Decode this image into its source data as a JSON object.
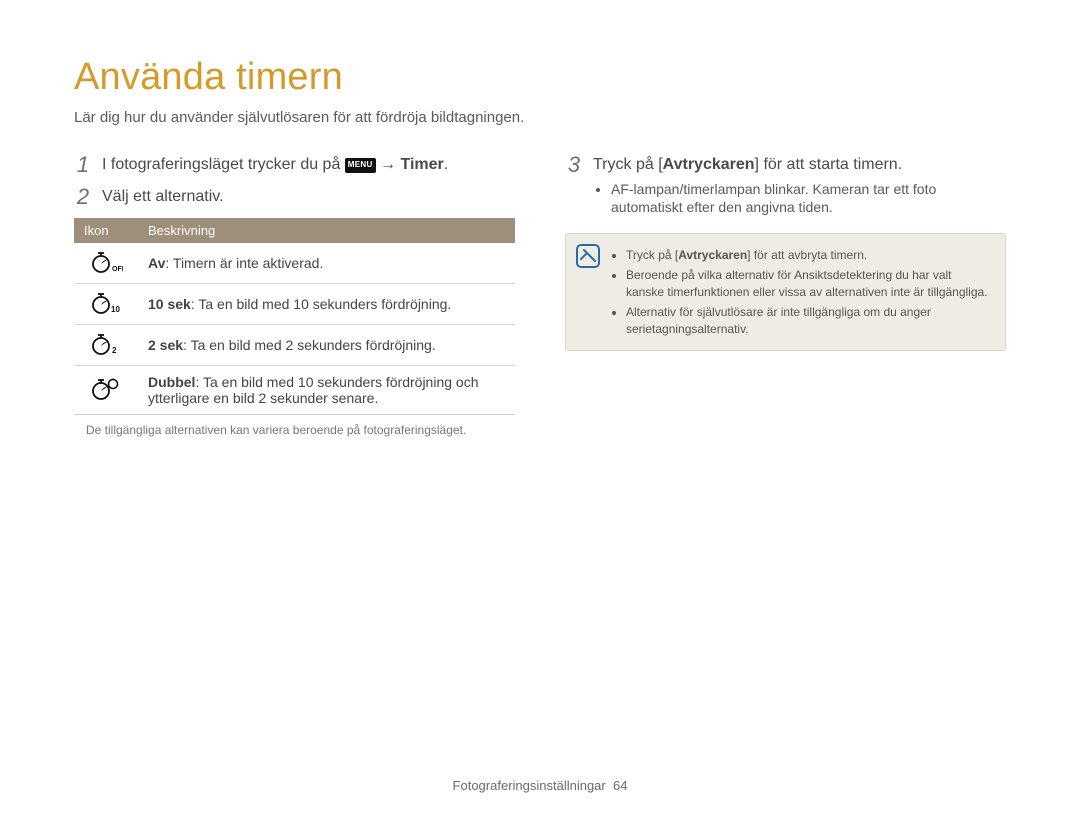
{
  "title": "Använda timern",
  "intro": "Lär dig hur du använder självutlösaren för att fördröja bildtagningen.",
  "left": {
    "step1": {
      "num": "1",
      "prefix": "I fotograferingsläget trycker du på ",
      "menu_chip": "MENU",
      "arrow": " → ",
      "bold": "Timer",
      "suffix": "."
    },
    "step2": {
      "num": "2",
      "text": "Välj ett alternativ."
    },
    "table": {
      "header_icon": "Ikon",
      "header_desc": "Beskrivning",
      "rows": [
        {
          "icon": "off",
          "bold": "Av",
          "rest": ": Timern är inte aktiverad."
        },
        {
          "icon": "ten",
          "bold": "10 sek",
          "rest": ": Ta en bild med 10 sekunders fördröjning."
        },
        {
          "icon": "two",
          "bold": "2 sek",
          "rest": ": Ta en bild med 2 sekunders fördröjning."
        },
        {
          "icon": "double",
          "bold": "Dubbel",
          "rest": ": Ta en bild med 10 sekunders fördröjning och ytterligare en bild 2 sekunder senare."
        }
      ]
    },
    "footnote": "De tillgängliga alternativen kan variera beroende på fotograferingsläget."
  },
  "right": {
    "step3": {
      "num": "3",
      "prefix": "Tryck på [",
      "bold": "Avtryckaren",
      "suffix": "] för att starta timern.",
      "bullets": [
        "AF-lampan/timerlampan blinkar. Kameran tar ett foto automatiskt efter den angivna tiden."
      ]
    },
    "note": {
      "items": [
        {
          "prefix": "Tryck på [",
          "bold": "Avtryckaren",
          "suffix": "] för att avbryta timern."
        },
        {
          "text": "Beroende på vilka alternativ för Ansiktsdetektering du har valt kanske timerfunktionen eller vissa av alternativen inte är tillgängliga."
        },
        {
          "text": "Alternativ för självutlösare är inte tillgängliga om du anger serietagningsalternativ."
        }
      ]
    }
  },
  "footer": {
    "section": "Fotograferingsinställningar",
    "page": "64"
  }
}
